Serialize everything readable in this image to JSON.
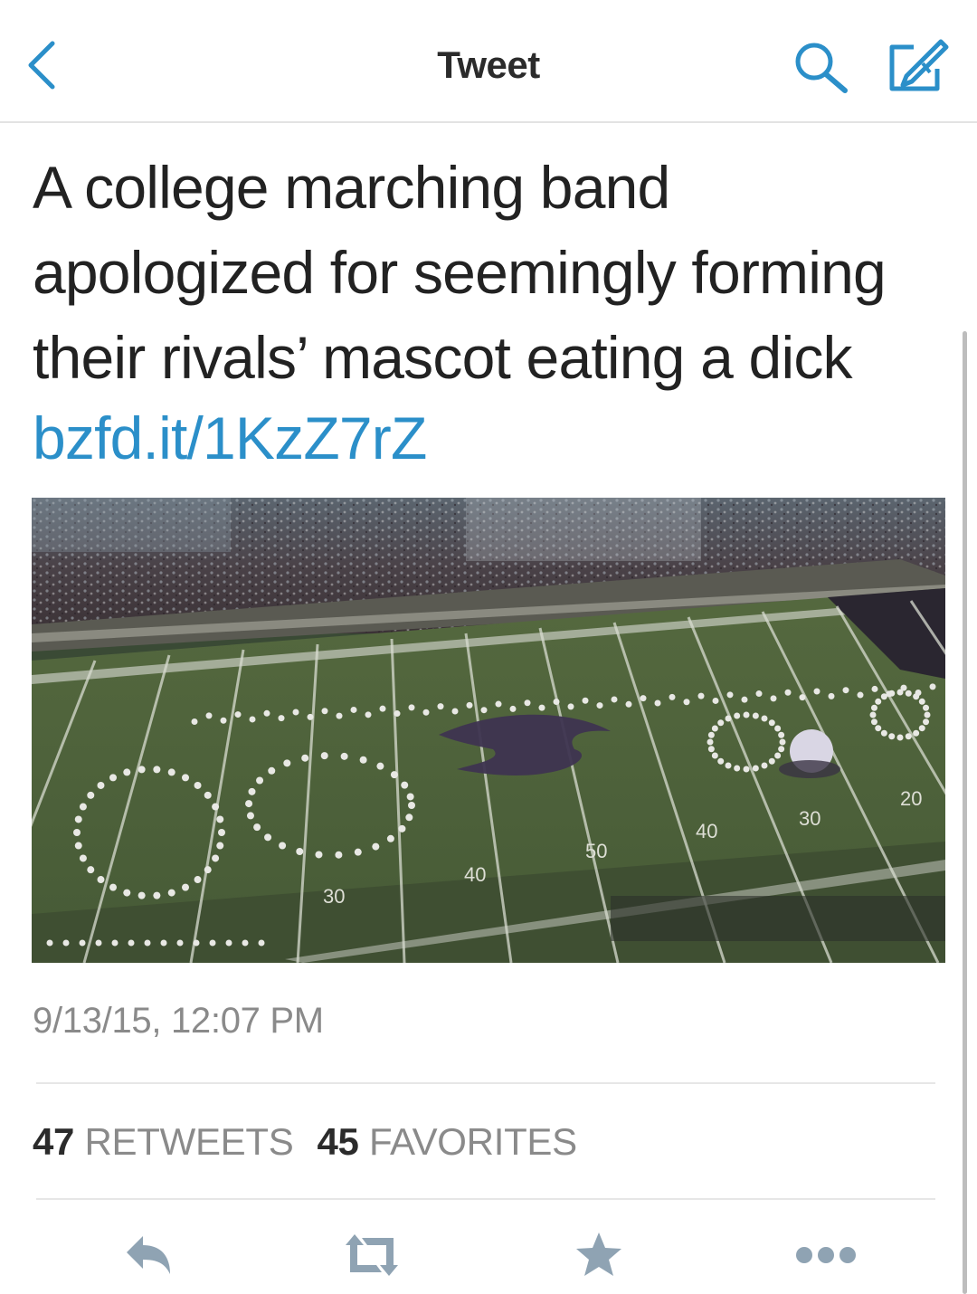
{
  "header": {
    "title": "Tweet",
    "back_icon": "chevron-left-icon",
    "search_icon": "search-icon",
    "compose_icon": "compose-icon"
  },
  "tweet": {
    "text_lines": [
      "A college marching band",
      "apologized for seemingly forming",
      "their rivals’ mascot eating a dick"
    ],
    "link": "bzfd.it/1KzZ7rZ",
    "media": {
      "yard_numbers": [
        "30",
        "40",
        "50",
        "40",
        "30",
        "20"
      ]
    },
    "timestamp": "9/13/15, 12:07 PM",
    "retweets_count": "47",
    "retweets_label": "RETWEETS",
    "favorites_count": "45",
    "favorites_label": "FAVORITES"
  },
  "actions": [
    "reply-icon",
    "retweet-icon",
    "favorite-star-icon",
    "more-dots-icon"
  ],
  "colors": {
    "link": "#2b8fc9",
    "nav_icons": "#2b8fc9",
    "action_icons": "#8fa3b3",
    "field_green": "#4a5e3a"
  }
}
